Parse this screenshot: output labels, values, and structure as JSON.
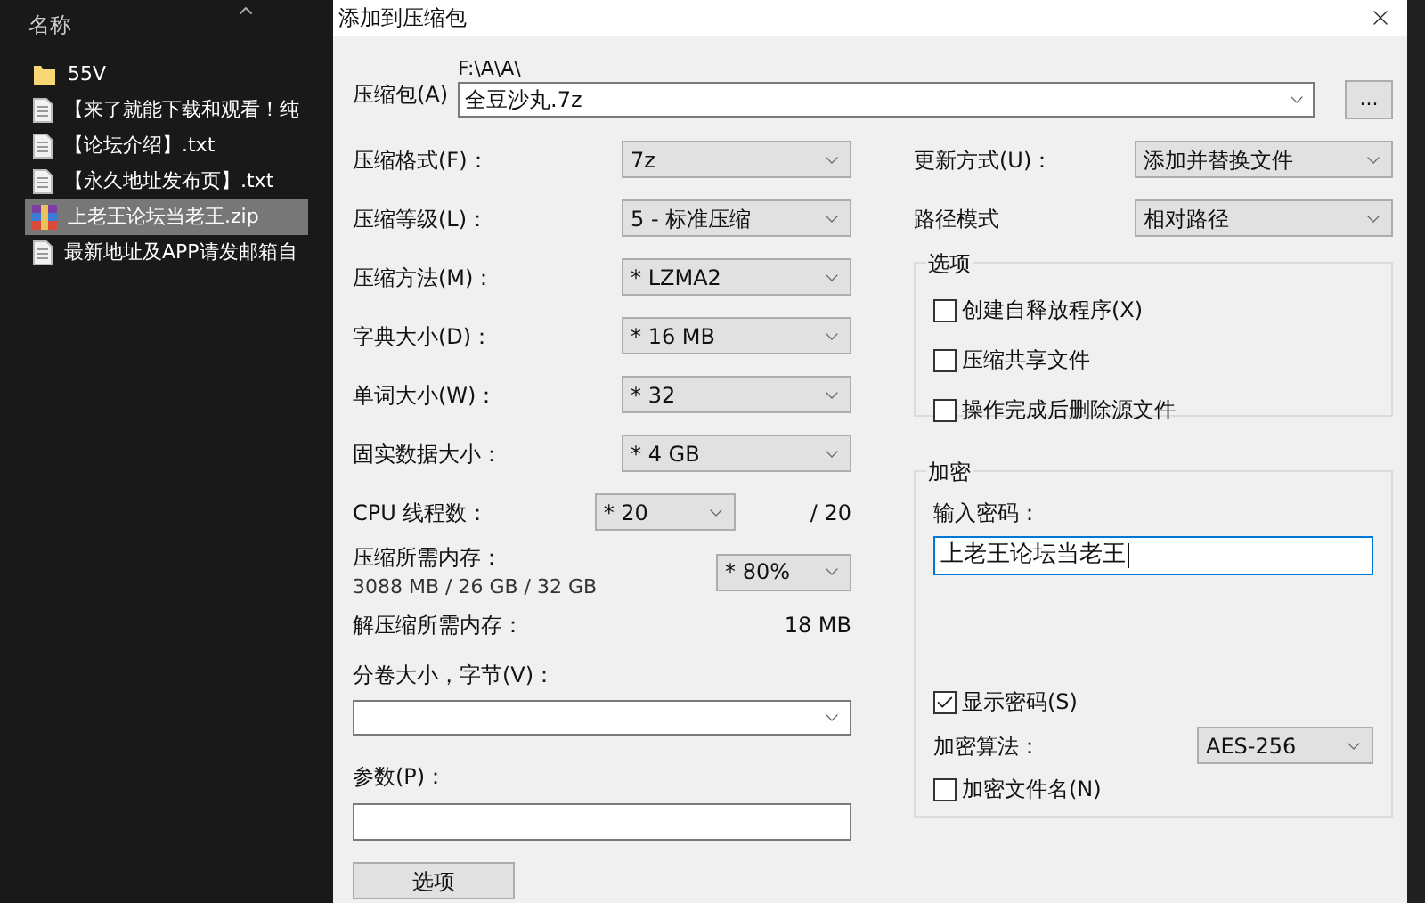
{
  "file_panel": {
    "header": "名称",
    "items": [
      {
        "name": "55V",
        "kind": "folder",
        "selected": false
      },
      {
        "name": "【来了就能下载和观看！纯",
        "kind": "text",
        "selected": false
      },
      {
        "name": "【论坛介绍】.txt",
        "kind": "text",
        "selected": false
      },
      {
        "name": "【永久地址发布页】.txt",
        "kind": "text",
        "selected": false
      },
      {
        "name": "上老王论坛当老王.zip",
        "kind": "archive",
        "selected": true
      },
      {
        "name": "最新地址及APP请发邮箱自",
        "kind": "text",
        "selected": false
      }
    ]
  },
  "dialog": {
    "title": "添加到压缩包",
    "archive": {
      "label": "压缩包(A)",
      "path": "F:\\A\\A\\",
      "value": "全豆沙丸.7z",
      "browse": "..."
    },
    "left_fields": [
      {
        "label": "压缩格式(F)：",
        "value": "7z"
      },
      {
        "label": "压缩等级(L)：",
        "value": "5 - 标准压缩"
      },
      {
        "label": "压缩方法(M)：",
        "value": "* LZMA2"
      },
      {
        "label": "字典大小(D)：",
        "value": "* 16 MB"
      },
      {
        "label": "单词大小(W)：",
        "value": "* 32"
      },
      {
        "label": "固实数据大小：",
        "value": "* 4 GB"
      }
    ],
    "threads": {
      "label": "CPU 线程数：",
      "value": "* 20",
      "total": "/ 20"
    },
    "memory": {
      "label": "压缩所需内存：",
      "detail": "3088 MB / 26 GB / 32 GB",
      "value": "* 80%"
    },
    "decompress_memory": {
      "label": "解压缩所需内存：",
      "value": "18 MB"
    },
    "split": {
      "label": "分卷大小，字节(V)："
    },
    "parameters": {
      "label": "参数(P)："
    },
    "options_button": "选项",
    "update_mode": {
      "label": "更新方式(U)：",
      "value": "添加并替换文件"
    },
    "path_mode": {
      "label": "路径模式",
      "value": "相对路径"
    },
    "options_group": {
      "title": "选项",
      "items": [
        {
          "label": "创建自释放程序(X)",
          "checked": false
        },
        {
          "label": "压缩共享文件",
          "checked": false
        },
        {
          "label": "操作完成后删除源文件",
          "checked": false
        }
      ]
    },
    "encryption": {
      "title": "加密",
      "password_label": "输入密码：",
      "password": "上老王论坛当老王",
      "show_password": {
        "label": "显示密码(S)",
        "checked": true
      },
      "method": {
        "label": "加密算法：",
        "value": "AES-256"
      },
      "encrypt_names": {
        "label": "加密文件名(N)",
        "checked": false
      }
    }
  }
}
